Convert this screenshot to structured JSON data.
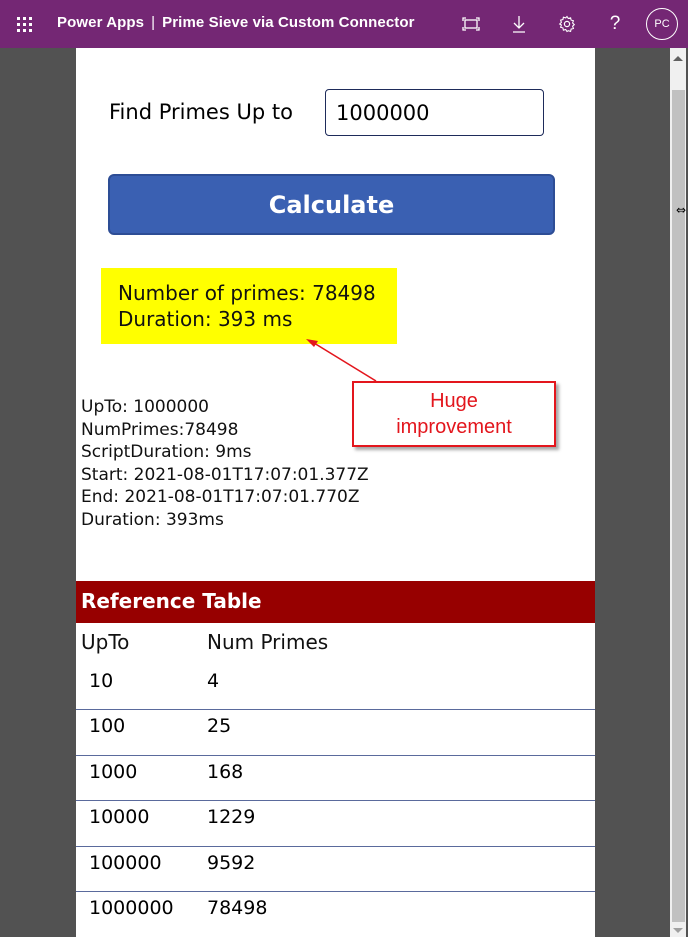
{
  "topbar": {
    "app_name": "Power Apps",
    "separator": "|",
    "app_title": "Prime Sieve via Custom Connector",
    "icons": [
      "waffle-icon",
      "fit-to-window-icon",
      "download-icon",
      "gear-icon",
      "help-icon"
    ],
    "avatar_initials": "PC",
    "brand_color": "#742774"
  },
  "form": {
    "label": "Find Primes Up to",
    "input_value": "1000000",
    "button_label": "Calculate",
    "button_color": "#3a60b2"
  },
  "result": {
    "num_primes_line": "Number of primes: 78498",
    "duration_line": "Duration: 393 ms",
    "highlight_color": "#ffff00"
  },
  "details": [
    "UpTo: 1000000",
    "NumPrimes:78498",
    "ScriptDuration: 9ms",
    "Start: 2021-08-01T17:07:01.377Z",
    "End: 2021-08-01T17:07:01.770Z",
    "Duration: 393ms"
  ],
  "annotation": {
    "line1": "Huge",
    "line2": "improvement",
    "color": "#e3161d"
  },
  "reference_table": {
    "title": "Reference Table",
    "header_color": "#970000",
    "columns": [
      "UpTo",
      "Num Primes"
    ],
    "rows": [
      {
        "upto": "10",
        "num_primes": "4"
      },
      {
        "upto": "100",
        "num_primes": "25"
      },
      {
        "upto": "1000",
        "num_primes": "168"
      },
      {
        "upto": "10000",
        "num_primes": "1229"
      },
      {
        "upto": "100000",
        "num_primes": "9592"
      },
      {
        "upto": "1000000",
        "num_primes": "78498"
      }
    ]
  }
}
